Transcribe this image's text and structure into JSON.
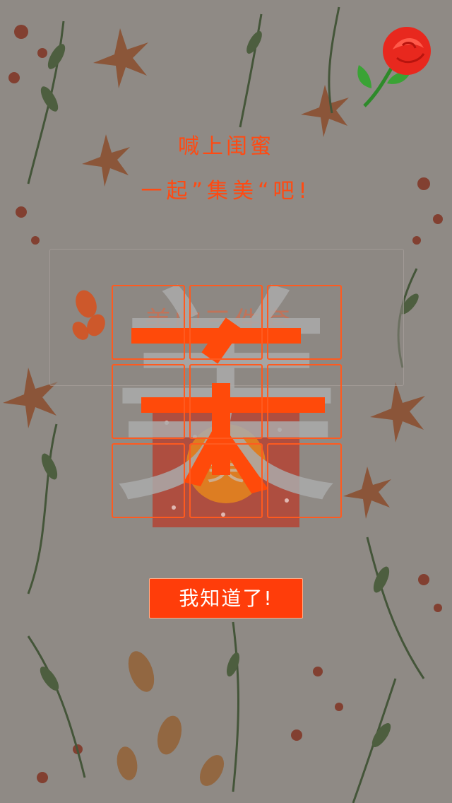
{
  "colors": {
    "accent": "#ff4a12",
    "button": "#ff3d0a",
    "grid": "#ff5a1f"
  },
  "headline": {
    "line1": "喊上闺蜜",
    "line2": "一起”集美“吧!"
  },
  "card": {
    "title": "美的三件套",
    "gift_char": "美"
  },
  "puzzle": {
    "char": "美",
    "rows": 3,
    "cols": 3
  },
  "button": {
    "label": "我知道了!"
  },
  "icons": {
    "background": "watercolor-floral-icon",
    "rose": "rose-icon",
    "petals": "petal-icon"
  }
}
